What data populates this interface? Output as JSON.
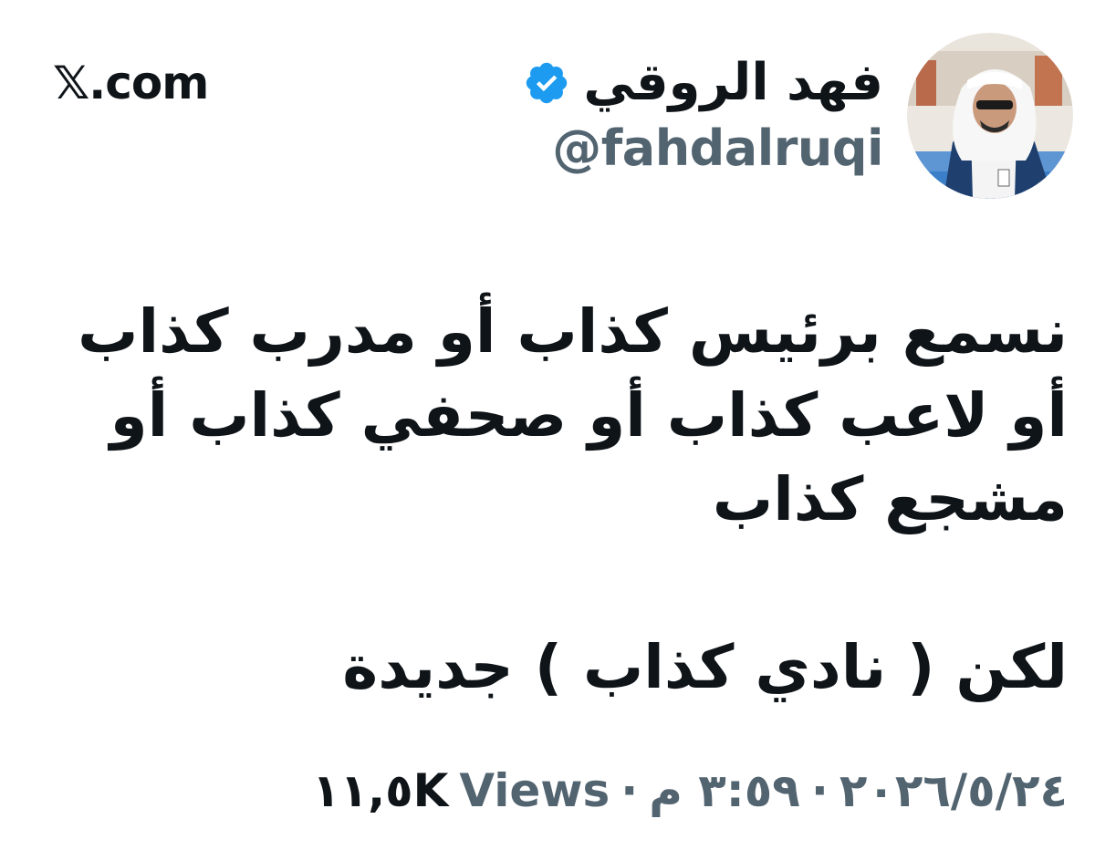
{
  "brand": {
    "site": ".com",
    "glyph": "𝕏"
  },
  "author": {
    "display_name": "فهد الروقي",
    "handle": "@fahdalruqi",
    "verified_icon": "verified-badge-icon",
    "avatar": "profile-photo"
  },
  "tweet": {
    "paragraph_1": "نسمع برئيس كذاب أو مدرب كذاب أو لاعب كذاب أو صحفي كذاب أو مشجع كذاب",
    "paragraph_2": "لكن ( نادي كذاب ) جديدة"
  },
  "meta": {
    "date": "٢٠٢٦/٥/٢٤",
    "separator": "·",
    "time": "٣:٥٩ م",
    "views_label": "Views",
    "views_count": "١١,٥K"
  },
  "colors": {
    "text": "#0f1419",
    "secondary": "#536471",
    "verified": "#1d9bf0"
  }
}
